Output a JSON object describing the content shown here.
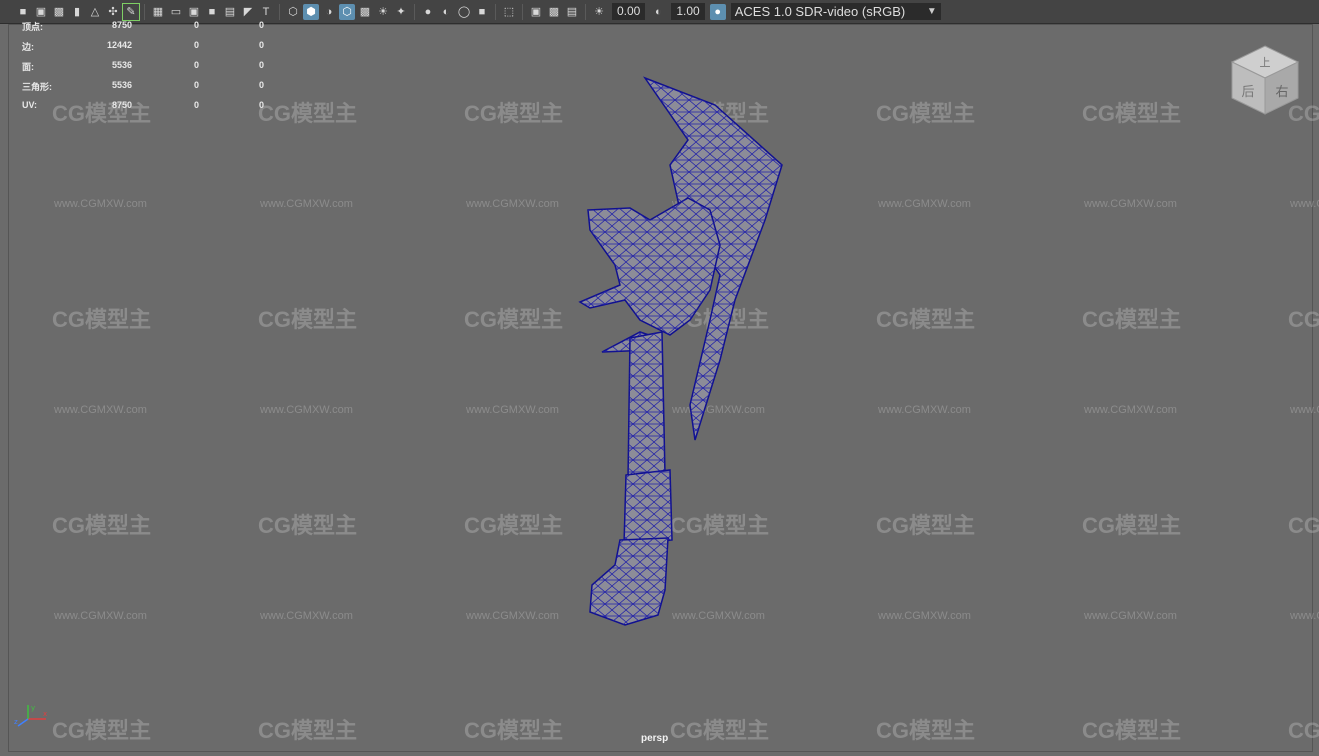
{
  "toolbar": {
    "icons": [
      "camera-icon",
      "camera-lock-icon",
      "camera-flip-icon",
      "bookmark-icon",
      "image-plane-icon",
      "pivot-icon",
      "grease-pencil-icon",
      "grid-icon",
      "film-gate-icon",
      "resolution-gate-icon",
      "gate-mask-icon",
      "field-chart-icon",
      "safe-action-icon",
      "safe-title-icon",
      "wireframe-icon",
      "smooth-shade-icon",
      "default-material-icon",
      "wireframe-on-shaded-icon",
      "xray-icon",
      "texture-icon",
      "use-all-lights-icon",
      "shadows-icon",
      "screen-space-ao-icon",
      "motion-blur-icon",
      "anti-aliasing-icon",
      "depth-of-field-icon",
      "isolate-select-icon",
      "xray-joints-icon",
      "xray-active-icon",
      "backface-culling-icon",
      "exposure-icon",
      "gamma-icon",
      "color-management-icon"
    ],
    "exposure_value": "0.00",
    "gamma_value": "1.00",
    "color_space": "ACES 1.0 SDR-video (sRGB)"
  },
  "hud": {
    "rows": [
      {
        "label": "顶点:",
        "v1": "8750",
        "v2": "0",
        "v3": "0"
      },
      {
        "label": "边:",
        "v1": "12442",
        "v2": "0",
        "v3": "0"
      },
      {
        "label": "面:",
        "v1": "5536",
        "v2": "0",
        "v3": "0"
      },
      {
        "label": "三角形:",
        "v1": "5536",
        "v2": "0",
        "v3": "0"
      },
      {
        "label": "UV:",
        "v1": "8750",
        "v2": "0",
        "v3": "0"
      }
    ]
  },
  "viewcube": {
    "top_label": "上",
    "front_label": "后",
    "right_label": "右"
  },
  "camera_label": "persp",
  "watermark": {
    "logo": "CG模型主",
    "url": "www.CGMXW.com"
  },
  "colors": {
    "background": "#6b6b6b",
    "wireframe": "#1a1aa0",
    "mesh_fill": "#8a8a96",
    "active_icon": "#5d8fb0"
  },
  "axis": {
    "x": "x",
    "y": "y",
    "z": "z"
  }
}
